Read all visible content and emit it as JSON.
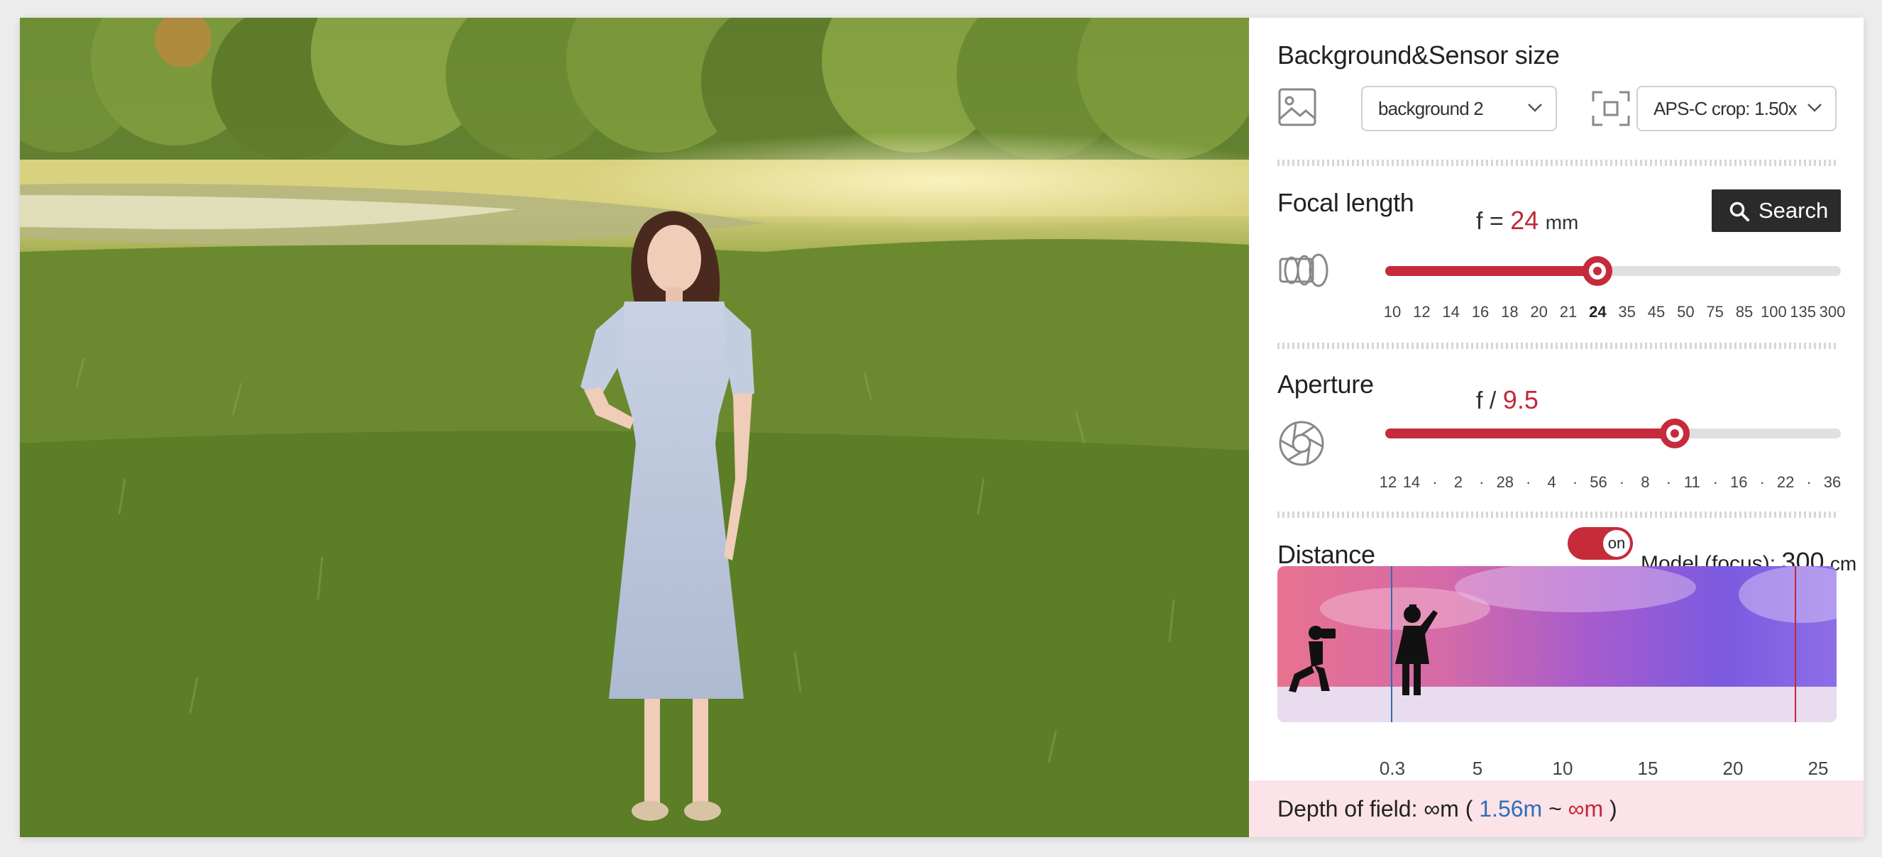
{
  "background_sensor": {
    "title": "Background&Sensor size",
    "background_select": "background 2",
    "sensor_select": "APS-C crop: 1.50x"
  },
  "focal_length": {
    "title": "Focal length",
    "prefix": "f =",
    "value": "24",
    "unit": "mm",
    "search_label": "Search",
    "ticks": [
      "10",
      "12",
      "14",
      "16",
      "18",
      "20",
      "21",
      "24",
      "35",
      "45",
      "50",
      "75",
      "85",
      "100",
      "135",
      "300"
    ],
    "selected_tick_index": 7
  },
  "aperture": {
    "title": "Aperture",
    "prefix": "f /",
    "value": "9.5",
    "ticks": [
      "12",
      "14",
      "·",
      "2",
      "·",
      "28",
      "·",
      "4",
      "·",
      "56",
      "·",
      "8",
      "·",
      "11",
      "·",
      "16",
      "·",
      "22",
      "·",
      "36"
    ],
    "selected_position": 0.636
  },
  "distance": {
    "title": "Distance",
    "toggle_label": "on",
    "model_label": "Model (focus):",
    "model_value": "300",
    "model_unit": "cm",
    "ticks": [
      "0.3",
      "5",
      "10",
      "15",
      "20",
      "25"
    ]
  },
  "depth_of_field": {
    "label": "Depth of field:",
    "total": "∞m",
    "open_paren": "(",
    "near": "1.56m",
    "separator": "~",
    "far": "∞m",
    "close_paren": ")"
  },
  "colors": {
    "accent_red": "#c62b3b",
    "near_blue": "#2f6db6",
    "dof_background": "#fbe3e8"
  },
  "icons": [
    "image-icon",
    "sensor-crop-icon",
    "lens-icon",
    "search-icon",
    "aperture-icon",
    "photographer-icon",
    "model-figure-icon",
    "chevron-down-icon"
  ]
}
